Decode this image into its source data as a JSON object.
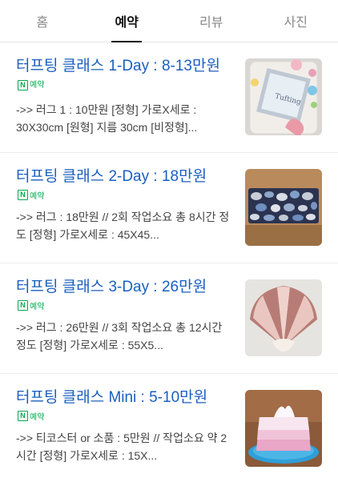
{
  "tabs": [
    {
      "label": "홈",
      "active": false
    },
    {
      "label": "예약",
      "active": true
    },
    {
      "label": "리뷰",
      "active": false
    },
    {
      "label": "사진",
      "active": false
    }
  ],
  "badge": {
    "icon": "naver-n-icon",
    "n": "N",
    "label": "예약",
    "color": "#03a94d"
  },
  "items": [
    {
      "title": "터프팅 클래스 1-Day : 8-13만원",
      "description": "->> 러그 1 : 10만원 [정형] 가로X세로 : 30X30cm [원형] 지름 30cm [비정형]...",
      "image": "tufting-mirror-frame-photo"
    },
    {
      "title": "터프팅 클래스 2-Day : 18만원",
      "description": "->> 러그 : 18만원 // 2회 작업소요 총 8시간 정도 [정형] 가로X세로 : 45X45...",
      "image": "stone-pattern-rug-photo"
    },
    {
      "title": "터프팅 클래스 3-Day : 26만원",
      "description": "->> 러그 : 26만원 // 3회 작업소요 총 12시간 정도 [정형] 가로X세로 : 55X5...",
      "image": "shell-rug-photo"
    },
    {
      "title": "터프팅 클래스 Mini : 5-10만원",
      "description": "->> 티코스터 or 소품 : 5만원 // 작업소요 약 2시간 [정형] 가로X세로 : 15X...",
      "image": "tissue-box-cover-photo"
    }
  ],
  "colors": {
    "link": "#1a5fbf",
    "accent": "#03a94d",
    "divider": "#ececec"
  }
}
